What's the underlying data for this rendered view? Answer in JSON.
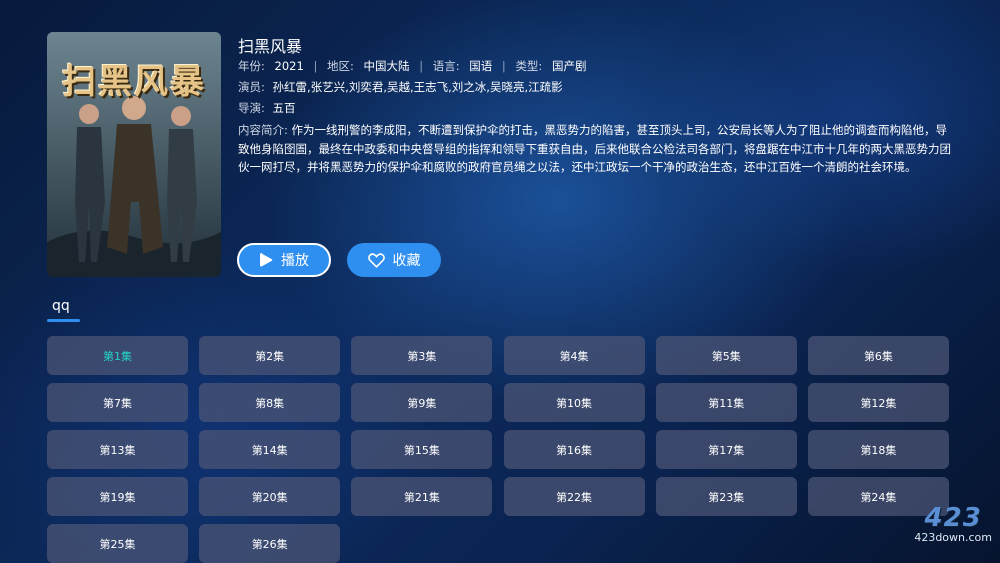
{
  "poster": {
    "title_art": "扫黑风暴"
  },
  "show": {
    "title": "扫黑风暴",
    "year_label": "年份:",
    "year": "2021",
    "region_label": "地区:",
    "region": "中国大陆",
    "language_label": "语言:",
    "language": "国语",
    "type_label": "类型:",
    "type": "国产剧",
    "separator": "|",
    "cast_label": "演员:",
    "cast": "孙红雷,张艺兴,刘奕君,吴越,王志飞,刘之冰,吴晓亮,江疏影",
    "director_label": "导演:",
    "director": "五百",
    "synopsis_label": "内容简介:",
    "synopsis": "作为一线刑警的李成阳，不断遭到保护伞的打击，黑恶势力的陷害，甚至顶头上司，公安局长等人为了阻止他的调查而构陷他，导致他身陷囹圄，最终在中政委和中央督导组的指挥和领导下重获自由，后来他联合公检法司各部门，将盘踞在中江市十几年的两大黑恶势力团伙一网打尽，并将黑恶势力的保护伞和腐败的政府官员绳之以法，还中江政坛一个干净的政治生态，还中江百姓一个清朗的社会环境。"
  },
  "actions": {
    "play_label": "播放",
    "favorite_label": "收藏"
  },
  "source": {
    "tab_label": "qq"
  },
  "episodes": [
    "第1集",
    "第2集",
    "第3集",
    "第4集",
    "第5集",
    "第6集",
    "第7集",
    "第8集",
    "第9集",
    "第10集",
    "第11集",
    "第12集",
    "第13集",
    "第14集",
    "第15集",
    "第16集",
    "第17集",
    "第18集",
    "第19集",
    "第20集",
    "第21集",
    "第22集",
    "第23集",
    "第24集",
    "第25集",
    "第26集"
  ],
  "active_episode": 0,
  "watermark": {
    "logo": "423",
    "site": "423down.com"
  },
  "colors": {
    "accent": "#2f8ff0",
    "active_episode_text": "#22d3c5"
  }
}
